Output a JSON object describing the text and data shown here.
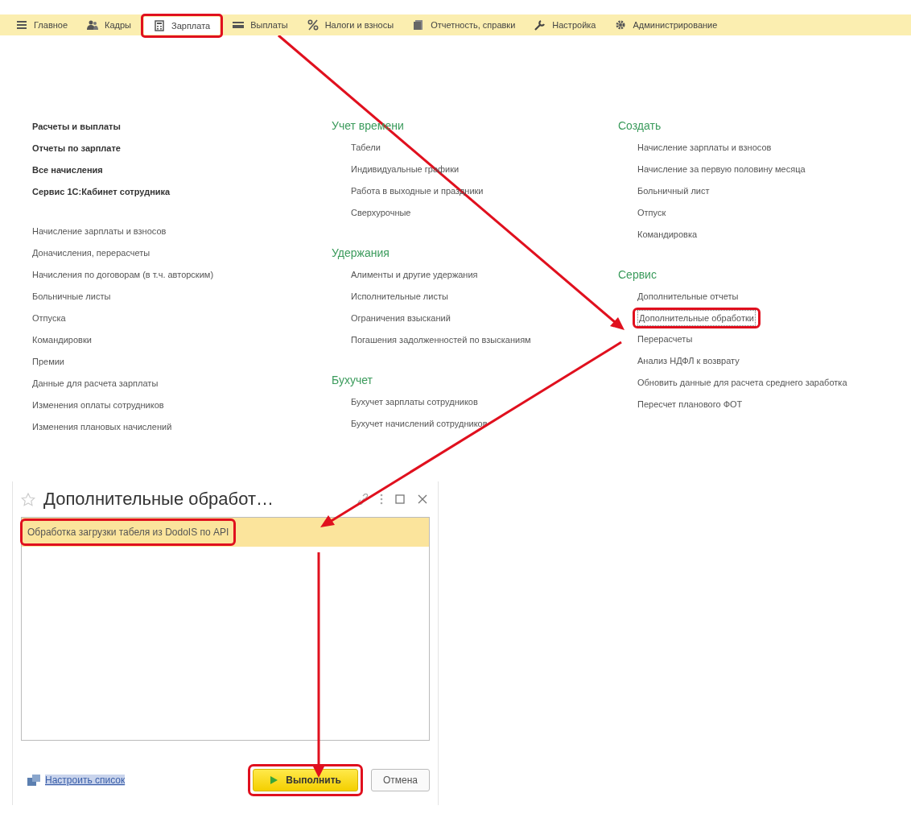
{
  "sections_bar": {
    "tabs": [
      {
        "label": "Главное",
        "selected": false,
        "highlighted": false
      },
      {
        "label": "Кадры",
        "selected": false,
        "highlighted": false
      },
      {
        "label": "Зарплата",
        "selected": true,
        "highlighted": true
      },
      {
        "label": "Выплаты",
        "selected": false,
        "highlighted": false
      },
      {
        "label": "Налоги и взносы",
        "selected": false,
        "highlighted": false
      },
      {
        "label": "Отчетность, справки",
        "selected": false,
        "highlighted": false
      },
      {
        "label": "Настройка",
        "selected": false,
        "highlighted": false
      },
      {
        "label": "Администрирование",
        "selected": false,
        "highlighted": false
      }
    ]
  },
  "panel": {
    "columns": [
      {
        "groups": [
          {
            "kind": "main",
            "items": [
              {
                "label": "Расчеты и выплаты",
                "highlighted": false
              },
              {
                "label": "Отчеты по зарплате",
                "highlighted": false
              },
              {
                "label": "Все начисления",
                "highlighted": false
              },
              {
                "label": "Сервис 1С:Кабинет сотрудника",
                "highlighted": false
              }
            ]
          },
          {
            "kind": "plain",
            "items": [
              {
                "label": "Начисление зарплаты и взносов",
                "highlighted": false
              },
              {
                "label": "Доначисления, перерасчеты",
                "highlighted": false
              },
              {
                "label": "Начисления по договорам (в т.ч. авторским)",
                "highlighted": false
              },
              {
                "label": "Больничные листы",
                "highlighted": false
              },
              {
                "label": "Отпуска",
                "highlighted": false
              },
              {
                "label": "Командировки",
                "highlighted": false
              },
              {
                "label": "Премии",
                "highlighted": false
              },
              {
                "label": "Данные для расчета зарплаты",
                "highlighted": false
              },
              {
                "label": "Изменения оплаты сотрудников",
                "highlighted": false
              },
              {
                "label": "Изменения плановых начислений",
                "highlighted": false
              }
            ]
          }
        ]
      },
      {
        "groups": [
          {
            "kind": "titled",
            "title": "Учет времени",
            "items": [
              {
                "label": "Табели",
                "highlighted": false
              },
              {
                "label": "Индивидуальные графики",
                "highlighted": false
              },
              {
                "label": "Работа в выходные и праздники",
                "highlighted": false
              },
              {
                "label": "Сверхурочные",
                "highlighted": false
              }
            ]
          },
          {
            "kind": "titled",
            "title": "Удержания",
            "items": [
              {
                "label": "Алименты и другие удержания",
                "highlighted": false
              },
              {
                "label": "Исполнительные листы",
                "highlighted": false
              },
              {
                "label": "Ограничения взысканий",
                "highlighted": false
              },
              {
                "label": "Погашения задолженностей по взысканиям",
                "highlighted": false
              }
            ]
          },
          {
            "kind": "titled",
            "title": "Бухучет",
            "items": [
              {
                "label": "Бухучет зарплаты сотрудников",
                "highlighted": false
              },
              {
                "label": "Бухучет начислений сотрудников",
                "highlighted": false
              }
            ]
          }
        ]
      },
      {
        "groups": [
          {
            "kind": "titled",
            "title": "Создать",
            "items": [
              {
                "label": "Начисление зарплаты и взносов",
                "highlighted": false
              },
              {
                "label": "Начисление за первую половину месяца",
                "highlighted": false
              },
              {
                "label": "Больничный лист",
                "highlighted": false
              },
              {
                "label": "Отпуск",
                "highlighted": false
              },
              {
                "label": "Командировка",
                "highlighted": false
              }
            ]
          },
          {
            "kind": "titled",
            "title": "Сервис",
            "items": [
              {
                "label": "Дополнительные отчеты",
                "highlighted": false
              },
              {
                "label": "Дополнительные обработки",
                "highlighted": true
              },
              {
                "label": "Перерасчеты",
                "highlighted": false
              },
              {
                "label": "Анализ НДФЛ к возврату",
                "highlighted": false
              },
              {
                "label": "Обновить данные для расчета среднего заработка",
                "highlighted": false
              },
              {
                "label": "Пересчет планового ФОТ",
                "highlighted": false
              }
            ]
          }
        ]
      }
    ]
  },
  "dialog": {
    "title": "Дополнительные обработ…",
    "rows": [
      {
        "label": "Обработка загрузки табеля из DodoIS по API",
        "selected": true,
        "highlighted": true
      }
    ],
    "link": "Настроить список",
    "buttons": [
      {
        "label": "Выполнить",
        "kind": "default",
        "highlighted": true
      },
      {
        "label": "Отмена",
        "kind": "normal",
        "highlighted": false
      }
    ]
  }
}
